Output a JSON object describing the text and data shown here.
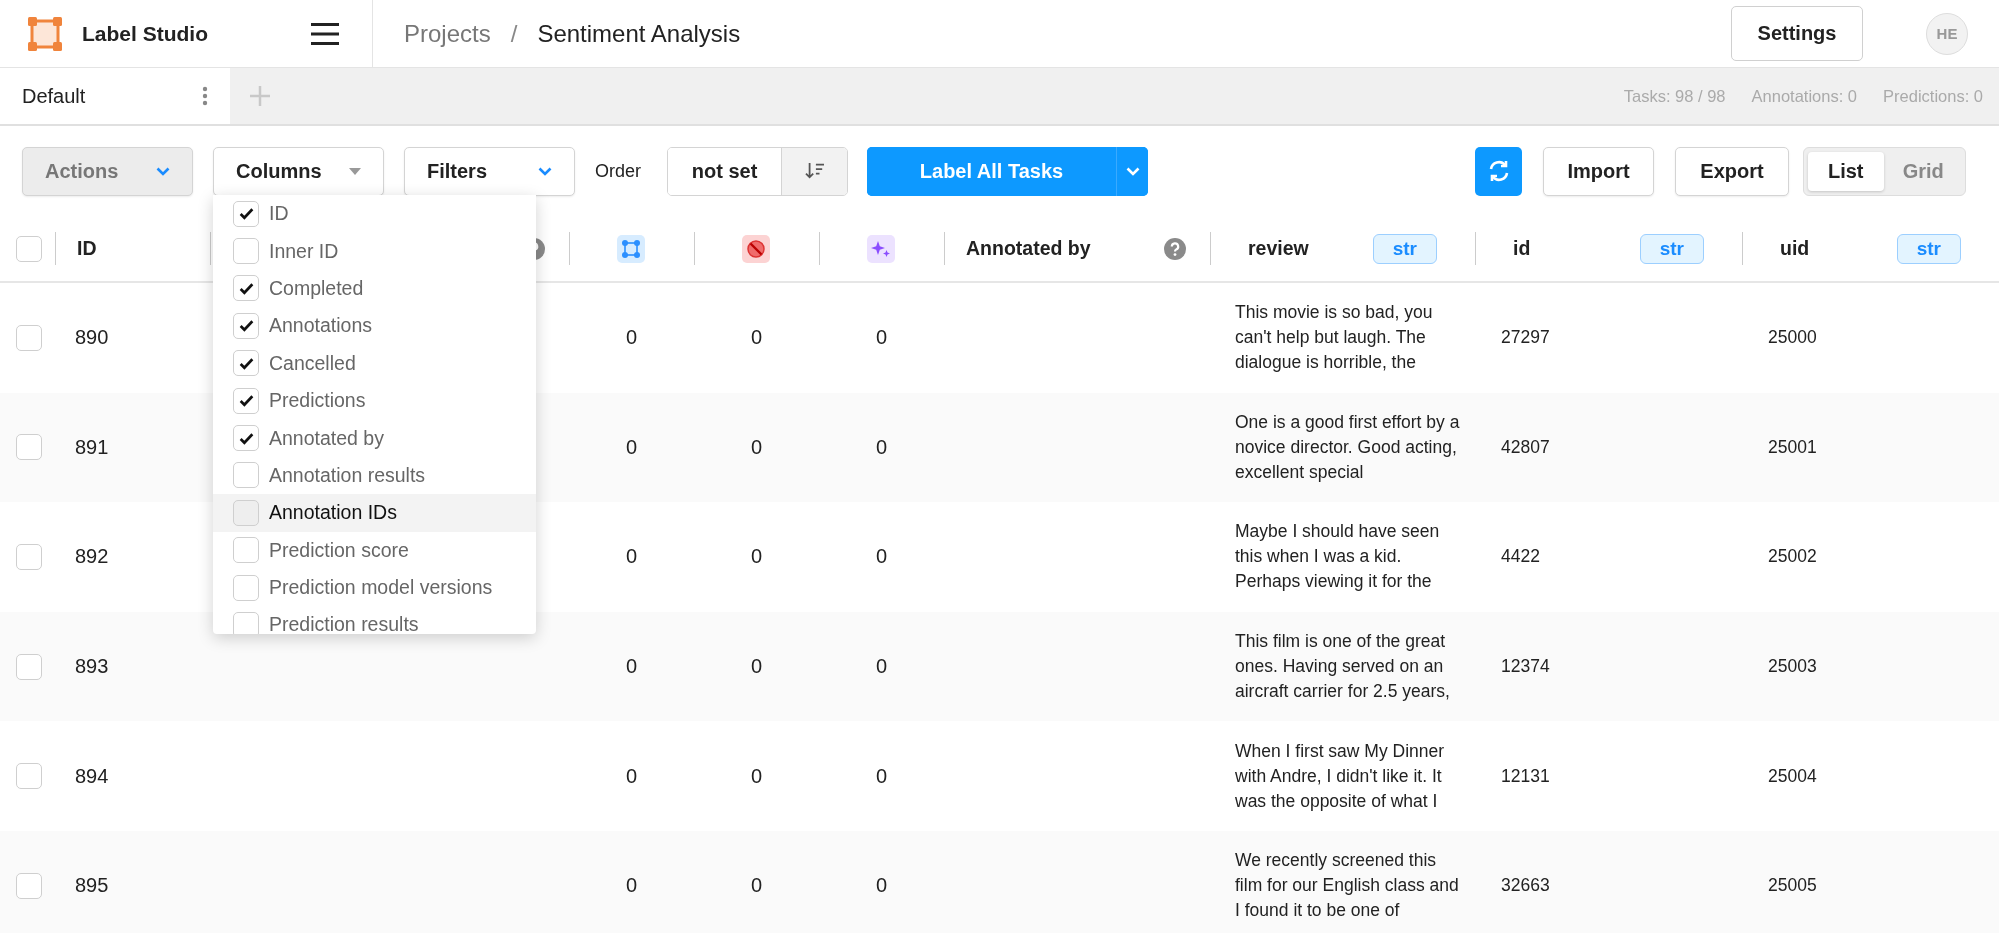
{
  "app": {
    "name": "Label Studio"
  },
  "breadcrumb": [
    {
      "label": "Projects",
      "current": false
    },
    {
      "label": "Sentiment Analysis",
      "current": true
    }
  ],
  "breadcrumb_separator": "/",
  "settings_button": "Settings",
  "avatar": "HE",
  "tabs": [
    {
      "label": "Default",
      "selected": true
    }
  ],
  "stats": [
    "Tasks: 98 / 98",
    "Annotations: 0",
    "Predictions: 0"
  ],
  "toolbar": {
    "actions": {
      "label": "Actions",
      "disabled": true
    },
    "columns": "Columns",
    "filters": "Filters",
    "order_label": "Order",
    "order_value": "not set",
    "label_all": "Label All Tasks",
    "import": "Import",
    "export": "Export",
    "view_modes": [
      {
        "label": "List",
        "selected": true
      },
      {
        "label": "Grid",
        "selected": false
      }
    ]
  },
  "column_menu": [
    {
      "label": "ID",
      "checked": true,
      "highlighted": false
    },
    {
      "label": "Inner ID",
      "checked": false,
      "highlighted": false
    },
    {
      "label": "Completed",
      "checked": true,
      "highlighted": false
    },
    {
      "label": "Annotations",
      "checked": true,
      "highlighted": false
    },
    {
      "label": "Cancelled",
      "checked": true,
      "highlighted": false
    },
    {
      "label": "Predictions",
      "checked": true,
      "highlighted": false
    },
    {
      "label": "Annotated by",
      "checked": true,
      "highlighted": false
    },
    {
      "label": "Annotation results",
      "checked": false,
      "highlighted": false
    },
    {
      "label": "Annotation IDs",
      "checked": false,
      "highlighted": true
    },
    {
      "label": "Prediction score",
      "checked": false,
      "highlighted": false
    },
    {
      "label": "Prediction model versions",
      "checked": false,
      "highlighted": false
    },
    {
      "label": "Prediction results",
      "checked": false,
      "highlighted": false
    }
  ],
  "table": {
    "all_checked": false,
    "columns": [
      {
        "kind": "text",
        "label": "ID"
      },
      {
        "kind": "help_only"
      },
      {
        "kind": "annotations_icon"
      },
      {
        "kind": "cancelled_icon"
      },
      {
        "kind": "predictions_icon"
      },
      {
        "kind": "help",
        "label": "Annotated by"
      },
      {
        "kind": "typed",
        "label": "review",
        "type": "str"
      },
      {
        "kind": "typed",
        "label": "id",
        "type": "str"
      },
      {
        "kind": "typed",
        "label": "uid",
        "type": "str"
      }
    ],
    "rows": [
      {
        "checked": false,
        "id": "890",
        "annotations": "0",
        "cancelled": "0",
        "predictions": "0",
        "review": "This movie is so bad, you can't help but laugh. The dialogue is horrible, the",
        "data_id": "27297",
        "uid": "25000"
      },
      {
        "checked": false,
        "id": "891",
        "annotations": "0",
        "cancelled": "0",
        "predictions": "0",
        "review": "One is a good first effort by a novice director. Good acting, excellent special",
        "data_id": "42807",
        "uid": "25001"
      },
      {
        "checked": false,
        "id": "892",
        "annotations": "0",
        "cancelled": "0",
        "predictions": "0",
        "review": "Maybe I should have seen this when I was a kid. Perhaps viewing it for the",
        "data_id": "4422",
        "uid": "25002"
      },
      {
        "checked": false,
        "id": "893",
        "annotations": "0",
        "cancelled": "0",
        "predictions": "0",
        "review": "This film is one of the great ones. Having served on an aircraft carrier for 2.5 years,",
        "data_id": "12374",
        "uid": "25003"
      },
      {
        "checked": false,
        "id": "894",
        "annotations": "0",
        "cancelled": "0",
        "predictions": "0",
        "review": "When I first saw My Dinner with Andre, I didn't like it. It was the opposite of what I",
        "data_id": "12131",
        "uid": "25004"
      },
      {
        "checked": false,
        "id": "895",
        "annotations": "0",
        "cancelled": "0",
        "predictions": "0",
        "review": "We recently screened this film for our English class and I found it to be one of",
        "data_id": "32663",
        "uid": "25005"
      }
    ]
  }
}
